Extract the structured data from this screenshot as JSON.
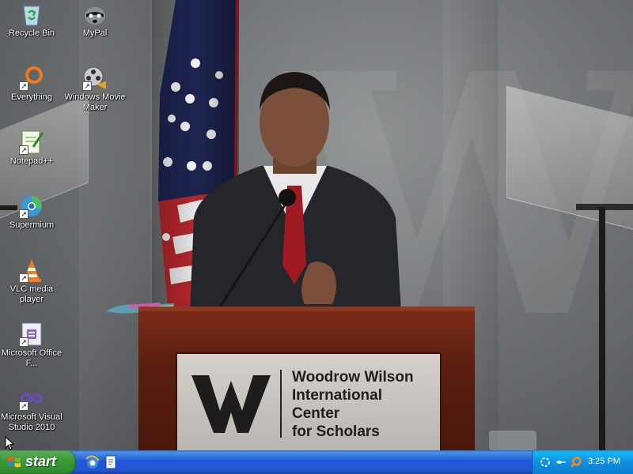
{
  "desktop": {
    "wallpaper": {
      "sign_lines": [
        "Woodrow Wilson",
        "International",
        "Center",
        "for Scholars"
      ]
    },
    "icons": [
      {
        "id": "recycle-bin",
        "label": "Recycle Bin",
        "icon": "recycle-bin-icon"
      },
      {
        "id": "mypal",
        "label": "MyPal",
        "icon": "mypal-raccoon-icon"
      },
      {
        "id": "everything",
        "label": "Everything",
        "icon": "everything-search-icon"
      },
      {
        "id": "windows-movie-maker",
        "label": "Windows Movie Maker",
        "icon": "movie-maker-film-icon"
      },
      {
        "id": "notepad-plus-plus",
        "label": "Notepad++",
        "icon": "notepad-plus-plus-icon"
      },
      {
        "id": "supermium",
        "label": "Supermium",
        "icon": "supermium-browser-icon"
      },
      {
        "id": "vlc",
        "label": "VLC media player",
        "icon": "vlc-cone-icon"
      },
      {
        "id": "office",
        "label": "Microsoft Office F...",
        "icon": "office-icon"
      },
      {
        "id": "visual-studio",
        "label": "Microsoft Visual Studio 2010",
        "icon": "visual-studio-icon"
      }
    ]
  },
  "taskbar": {
    "start_label": "start",
    "quick_launch": [
      {
        "name": "internet-explorer-icon"
      },
      {
        "name": "file-icon"
      }
    ],
    "tray": {
      "icons": [
        "network-icon",
        "volume-icon",
        "search-icon"
      ],
      "clock": "3:25 PM"
    }
  },
  "colors": {
    "taskbar_blue": "#2157d7",
    "start_green": "#3c9a3a",
    "tray_blue": "#0f8fe0",
    "podium_wood": "#5a1e10"
  }
}
